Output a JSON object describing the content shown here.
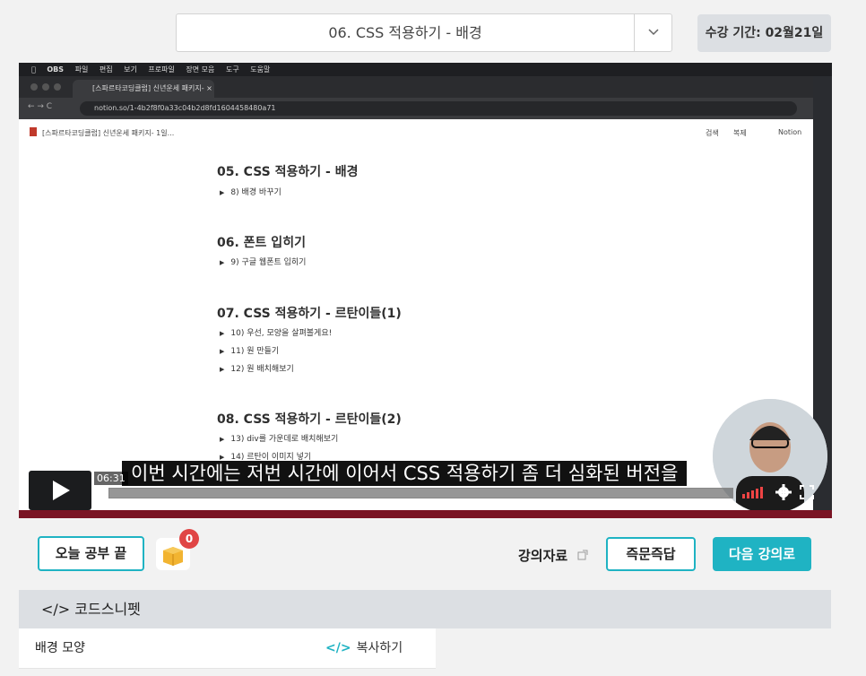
{
  "header": {
    "lesson_select": "06. CSS 적용하기 - 배경",
    "period": "수강 기간: 02월21일"
  },
  "video": {
    "menubar": [
      "OBS",
      "파일",
      "편집",
      "보기",
      "프로파일",
      "장면 모음",
      "도구",
      "도움말"
    ],
    "tab_title": "[스파르타코딩클럽] 신년운세 패키지- ×",
    "url": "notion.so/1-4b2f8f0a33c04b2d8fd1604458480a71",
    "page_breadcrumb": "[스파르타코딩클럽] 신년운세 패키지- 1일...",
    "notion_actions": [
      "검색",
      "복제",
      "Notion"
    ],
    "sections": [
      {
        "title": "05. CSS 적용하기 - 배경",
        "items": [
          "8) 배경 바꾸기"
        ]
      },
      {
        "title": "06. 폰트 입히기",
        "items": [
          "9) 구글 웹폰트 입히기"
        ]
      },
      {
        "title": "07. CSS 적용하기 - 르탄이들(1)",
        "items": [
          "10) 우선, 모양을 살펴볼게요!",
          "11) 원 만들기",
          "12) 원 배치해보기"
        ]
      },
      {
        "title": "08. CSS 적용하기 - 르탄이들(2)",
        "items": [
          "13) div를 가운데로 배치해보기",
          "14) 르탄이 이미지 넣기"
        ]
      }
    ],
    "subtitle": "이번 시간에는 저번 시간에 이어서 CSS 적용하기 좀 더 심화된 버전을",
    "time": "06:31",
    "progress": 0
  },
  "actions": {
    "today_done": "오늘 공부 끝",
    "badge_count": "0",
    "materials": "강의자료",
    "qa": "즉문즉답",
    "next": "다음 강의로"
  },
  "snippet": {
    "header": "</> 코드스니펫",
    "rows": [
      {
        "name": "배경 모양",
        "copy": "복사하기"
      }
    ]
  },
  "colors": {
    "accent": "#1fb3c3",
    "badge": "#e04545",
    "video_bar": "#c0233a"
  }
}
